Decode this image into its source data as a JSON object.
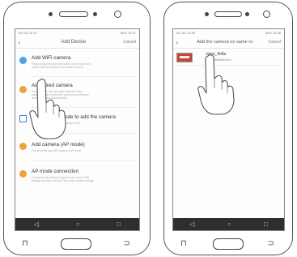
{
  "left_phone": {
    "status_left": "5G 4G 14:37",
    "status_right": "85% 14:37",
    "title": "Add Device",
    "cancel": "Cancel",
    "items": [
      {
        "title": "Add WiFi camera",
        "desc": [
          "Please long press the reset button on the camera to",
          "restore factory default if it was added already"
        ]
      },
      {
        "title": "Add wired camera",
        "desc": [
          "Please plug in the LAN cable attached to the",
          "camera. Please remove the camera from previous",
          "account if it was added already"
        ]
      },
      {
        "title": "Scan the QR code to add the camera",
        "desc": [
          "Scan the QR code on camera body to add"
        ]
      },
      {
        "title": "Add camera (AP mode)",
        "desc": [
          "The next time use WiFi camera in AP mode"
        ]
      },
      {
        "title": "AP mode connection",
        "desc": [
          "Connect to cam device hotspot in your phone WiFi",
          "settings and then connect. Then enter camera settings"
        ]
      }
    ],
    "nav": [
      "◁",
      "○",
      "□"
    ]
  },
  "right_phone": {
    "status_left": "5G 4G 14:38",
    "status_right": "85% 14:38",
    "title": "Add the camera on same ro",
    "cancel": "Cancel",
    "camera_name": "robot_4b8a",
    "camera_id": "c7f6e6f5bfbec5cb",
    "nav": [
      "◁",
      "○",
      "□"
    ]
  },
  "colors": {
    "accent": "#2a8fe0",
    "orange": "#f2a03d",
    "nav": "#2e2e2e"
  }
}
